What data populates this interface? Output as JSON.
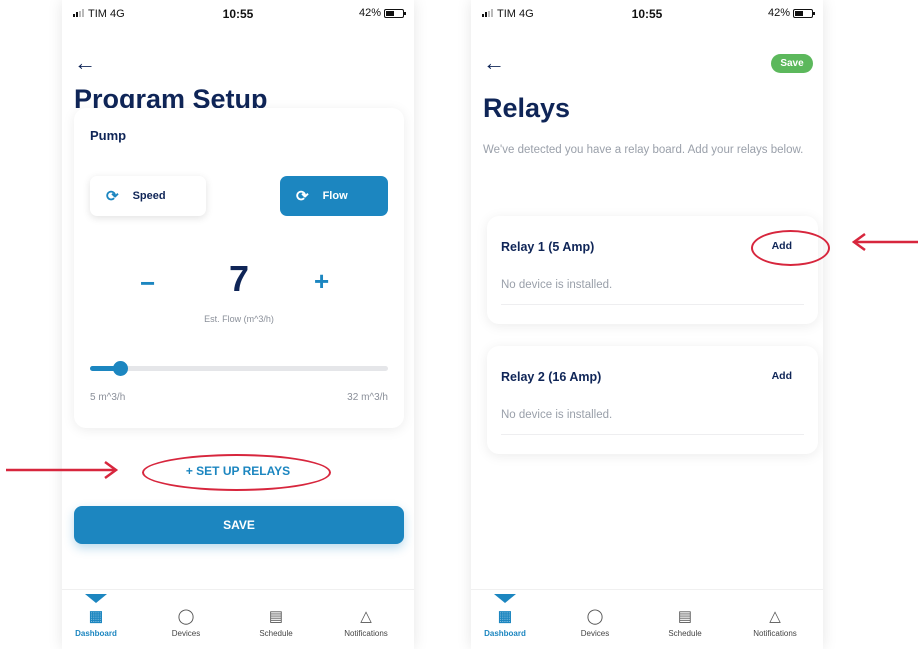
{
  "left_screen": {
    "status_bar": {
      "carrier": "TIM  4G",
      "time": "10:55",
      "battery": "42%"
    },
    "title": "Program Setup",
    "pump_card": {
      "label": "Pump",
      "speed_label": "Speed",
      "flow_label": "Flow",
      "selected_mode": "Flow",
      "minus": "−",
      "plus": "+",
      "value": "7",
      "caption": "Est. Flow (m^3/h)",
      "slider": {
        "min_label": "5 m^3/h",
        "max_label": "32 m^3/h",
        "min": 5,
        "max": 32,
        "value": 7
      }
    },
    "setup_relays_label": "+ SET UP RELAYS",
    "save_label": "SAVE"
  },
  "right_screen": {
    "status_bar": {
      "carrier": "TIM  4G",
      "time": "10:55",
      "battery": "42%"
    },
    "save_label": "Save",
    "title": "Relays",
    "description": "We've detected you have a relay board. Add your relays below.",
    "relays": [
      {
        "title": "Relay 1 (5 Amp)",
        "add_label": "Add",
        "status": "No device is installed."
      },
      {
        "title": "Relay 2 (16 Amp)",
        "add_label": "Add",
        "status": "No device is installed."
      }
    ]
  },
  "tabs": [
    {
      "label": "Dashboard",
      "icon": "dashboard-grid-icon",
      "active": true
    },
    {
      "label": "Devices",
      "icon": "droplet-icon",
      "active": false
    },
    {
      "label": "Schedule",
      "icon": "calendar-icon",
      "active": false
    },
    {
      "label": "Notifications",
      "icon": "bell-icon",
      "active": false
    }
  ],
  "colors": {
    "primary": "#1c86c0",
    "navy": "#0f2557",
    "save_green": "#5cb85c",
    "annotation_red": "#d7263d"
  }
}
